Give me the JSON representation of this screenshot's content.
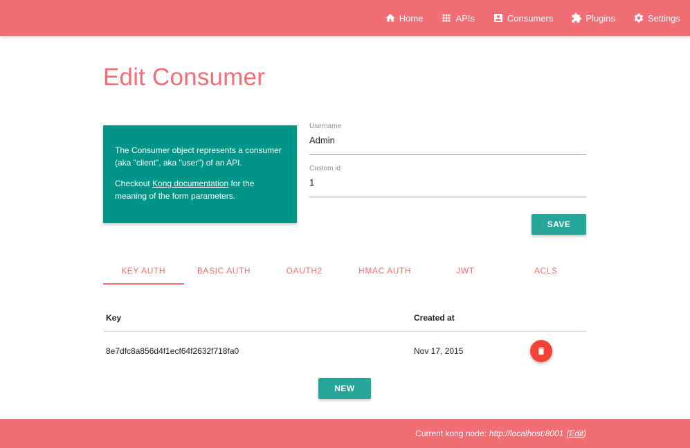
{
  "navbar": {
    "items": [
      {
        "label": "Home",
        "icon": "home-icon"
      },
      {
        "label": "APIs",
        "icon": "grid-icon"
      },
      {
        "label": "Consumers",
        "icon": "contact-card-icon"
      },
      {
        "label": "Plugins",
        "icon": "puzzle-icon"
      },
      {
        "label": "Settings",
        "icon": "gear-icon"
      }
    ]
  },
  "page": {
    "title": "Edit Consumer"
  },
  "info_card": {
    "paragraph1": "The Consumer object represents a consumer (aka \"client\", aka \"user\") of an API.",
    "paragraph2_prefix": "Checkout ",
    "paragraph2_link": "Kong documentation",
    "paragraph2_suffix": " for the meaning of the form parameters."
  },
  "form": {
    "username_label": "Username",
    "username_value": "Admin",
    "custom_id_label": "Custom id",
    "custom_id_value": "1",
    "save_label": "SAVE"
  },
  "tabs": [
    {
      "label": "KEY AUTH",
      "active": true
    },
    {
      "label": "BASIC AUTH",
      "active": false
    },
    {
      "label": "OAUTH2",
      "active": false
    },
    {
      "label": "HMAC AUTH",
      "active": false
    },
    {
      "label": "JWT",
      "active": false
    },
    {
      "label": "ACLS",
      "active": false
    }
  ],
  "table": {
    "headers": {
      "key": "Key",
      "created_at": "Created at"
    },
    "rows": [
      {
        "key": "8e7dfc8a856d4f1ecf64f2632f718fa0",
        "created_at": "Nov 17, 2015"
      }
    ],
    "new_label": "NEW"
  },
  "footer": {
    "prefix": "Current kong node:",
    "node_url": "http://localhost:8001",
    "edit_open": "(",
    "edit_label": "Edit",
    "edit_close": ")"
  },
  "colors": {
    "brand": "#f36d74",
    "info_card": "#009587",
    "button": "#26a69a",
    "delete": "#f44336"
  }
}
